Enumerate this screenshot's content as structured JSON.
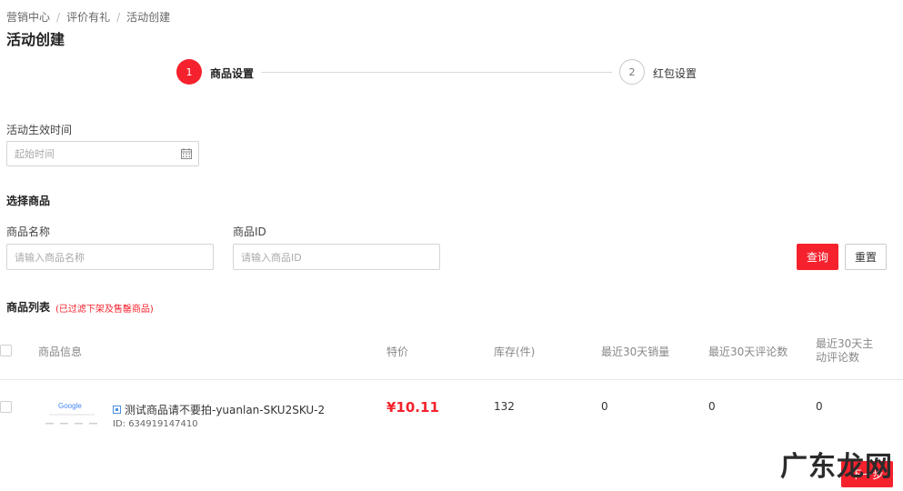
{
  "breadcrumb": [
    "营销中心",
    "评价有礼",
    "活动创建"
  ],
  "page_title": "活动创建",
  "steps": [
    {
      "number": "1",
      "label": "商品设置",
      "state": "active"
    },
    {
      "number": "2",
      "label": "红包设置",
      "state": "pending"
    }
  ],
  "effective_time": {
    "label": "活动生效时间",
    "placeholder": "起始时间",
    "icon": "calendar-icon"
  },
  "select_products": {
    "title": "选择商品",
    "name_label": "商品名称",
    "name_placeholder": "请输入商品名称",
    "id_label": "商品ID",
    "id_placeholder": "请输入商品ID",
    "query_button": "查询",
    "reset_button": "重置"
  },
  "product_list": {
    "title": "商品列表",
    "note": "(已过滤下架及售罄商品)",
    "columns": [
      "商品信息",
      "特价",
      "库存(件)",
      "最近30天销量",
      "最近30天评论数",
      "最近30天主动评论数"
    ],
    "rows": [
      {
        "name": "测试商品请不要拍-yuanlan-SKU2SKU-2",
        "id": "ID: 634919147410",
        "price": "¥10.11",
        "stock": "132",
        "sales_30d": "0",
        "reviews_30d": "0",
        "active_reviews_30d": "0"
      }
    ]
  },
  "thumbnail_text": "Google",
  "watermark": "广东龙网",
  "next_button": "下一步",
  "colors": {
    "accent": "#f5222d",
    "text": "#333333",
    "muted": "#888888",
    "border": "#d5d5d5"
  }
}
